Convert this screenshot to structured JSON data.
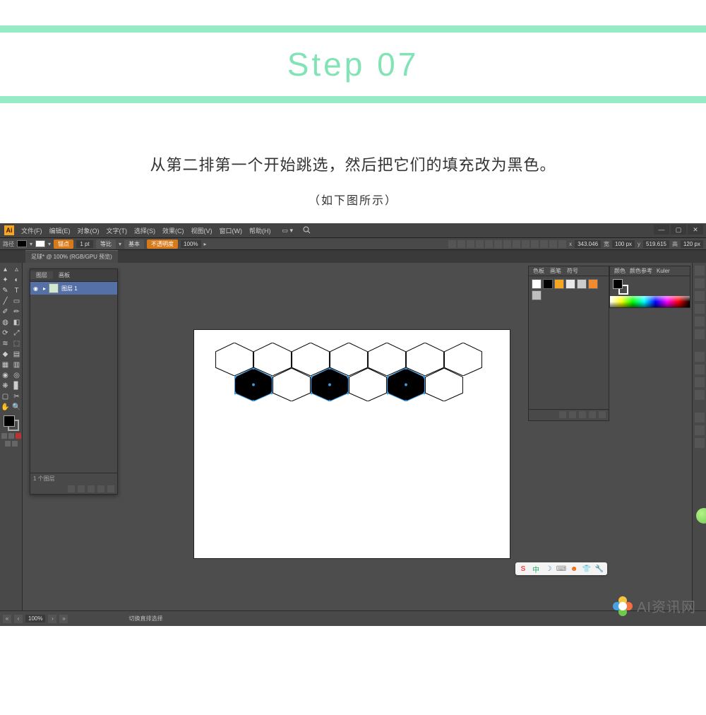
{
  "header": {
    "step_title": "Step 07",
    "instruction": "从第二排第一个开始跳选，然后把它们的填充改为黑色。",
    "sub_instruction": "（如下图所示）"
  },
  "menubar": {
    "items": [
      "文件(F)",
      "编辑(E)",
      "对象(O)",
      "文字(T)",
      "选择(S)",
      "效果(C)",
      "视图(V)",
      "窗口(W)",
      "帮助(H)"
    ]
  },
  "optionsbar": {
    "label_path": "路径",
    "anchor_label": "锚点",
    "stroke_weight": "1 pt",
    "uniform_label": "等比",
    "basic_label": "基本",
    "opacity_label": "不透明度",
    "opacity_value": "100%",
    "transform_x_label": "x",
    "transform_x": "343.046",
    "transform_w_label": "宽",
    "transform_w": "100 px",
    "transform_y_label": "y",
    "transform_y": "519.615",
    "transform_h_label": "高",
    "transform_h": "120 px"
  },
  "doctab": {
    "title": "足球* @ 100% (RGB/GPU 预览)"
  },
  "layers_panel": {
    "tabs": [
      "图层",
      "画板"
    ],
    "layer_name": "图层 1",
    "footer_text": "1 个图层"
  },
  "color_panel": {
    "tabs": [
      "颜色",
      "颜色参考",
      "Kuler"
    ]
  },
  "swatch_panel": {
    "tabs": [
      "色板",
      "画笔",
      "符号"
    ],
    "swatches": [
      "#ffffff",
      "#000000",
      "#f5a623",
      "#e8e8e8",
      "#cccccc",
      "#f08c2e",
      "#bfbfbf"
    ]
  },
  "statusbar": {
    "zoom": "100%",
    "label": "切换直排选择"
  },
  "ime": {
    "brand": "S",
    "lang": "中"
  },
  "watermark": {
    "text": "AI资讯网"
  },
  "hexagons": {
    "row1_count": 7,
    "row2": [
      {
        "filled": true
      },
      {
        "filled": false
      },
      {
        "filled": true
      },
      {
        "filled": false
      },
      {
        "filled": true
      },
      {
        "filled": false
      }
    ]
  }
}
